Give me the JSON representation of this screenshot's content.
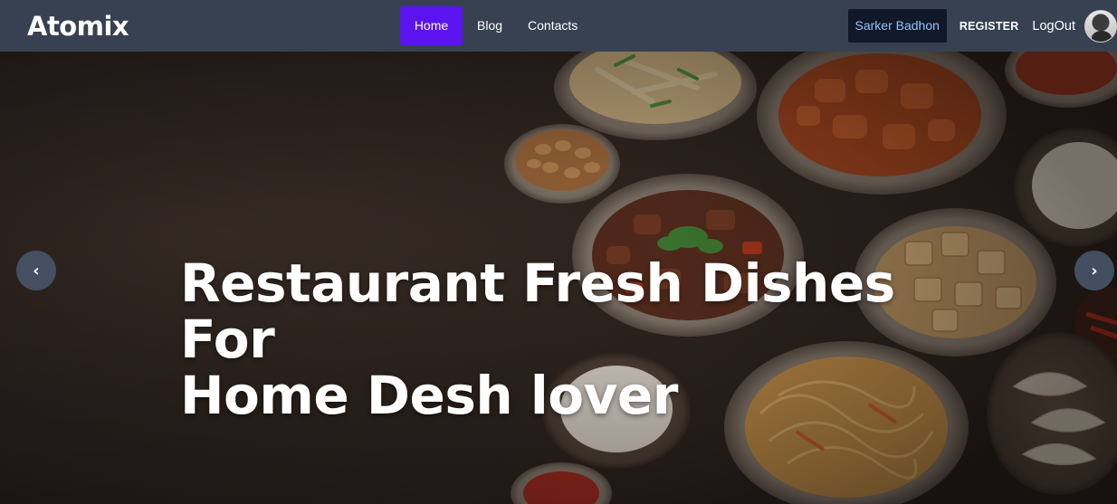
{
  "navbar": {
    "brand": "Atomix",
    "links": [
      {
        "label": "Home",
        "active": true
      },
      {
        "label": "Blog",
        "active": false
      },
      {
        "label": "Contacts",
        "active": false
      }
    ],
    "user_name": "Sarker Badhon",
    "register_label": "REGISTER",
    "logout_label": "LogOut"
  },
  "hero": {
    "headline_line1": "Restaurant Fresh Dishes For",
    "headline_line2": "Home Desh lover",
    "prev_icon": "‹",
    "next_icon": "›"
  },
  "colors": {
    "navbar_bg": "#374151",
    "active_link_bg": "#5b14f0",
    "user_badge_bg": "#111827",
    "user_badge_text": "#93c5fd"
  }
}
